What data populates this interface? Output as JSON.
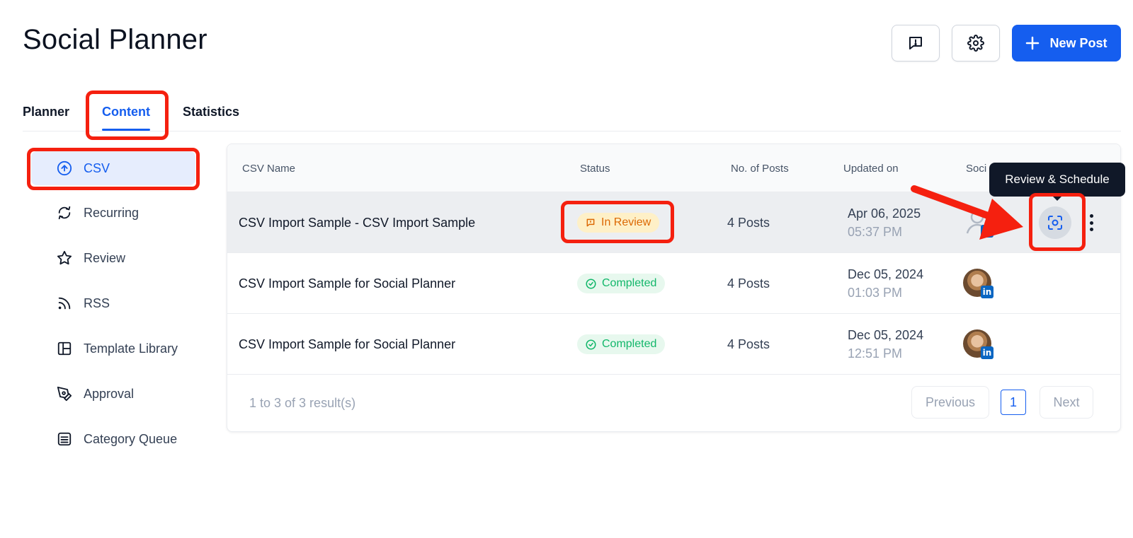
{
  "header": {
    "title": "Social Planner",
    "new_post_label": "New Post",
    "feedback_icon": "feedback-icon",
    "settings_icon": "gear-icon"
  },
  "tabs": [
    {
      "label": "Planner",
      "active": false
    },
    {
      "label": "Content",
      "active": true
    },
    {
      "label": "Statistics",
      "active": false
    }
  ],
  "sidebar": {
    "items": [
      {
        "label": "CSV",
        "icon": "upload-circle-icon",
        "active": true
      },
      {
        "label": "Recurring",
        "icon": "refresh-icon",
        "active": false
      },
      {
        "label": "Review",
        "icon": "star-icon",
        "active": false
      },
      {
        "label": "RSS",
        "icon": "rss-icon",
        "active": false
      },
      {
        "label": "Template Library",
        "icon": "layout-icon",
        "active": false
      },
      {
        "label": "Approval",
        "icon": "pen-icon",
        "active": false
      },
      {
        "label": "Category Queue",
        "icon": "list-icon",
        "active": false
      }
    ]
  },
  "table": {
    "columns": [
      "CSV Name",
      "Status",
      "No. of Posts",
      "Updated on",
      "Soci"
    ],
    "rows": [
      {
        "name": "CSV Import Sample  -  CSV Import Sample",
        "status": "In Review",
        "posts": "4 Posts",
        "date": "Apr 06, 2025",
        "time": "05:37 PM",
        "avatar": "placeholder",
        "network": "in"
      },
      {
        "name": "CSV Import Sample for Social Planner",
        "status": "Completed",
        "posts": "4 Posts",
        "date": "Dec 05, 2024",
        "time": "01:03 PM",
        "avatar": "photo",
        "network": "in"
      },
      {
        "name": "CSV Import Sample for Social Planner",
        "status": "Completed",
        "posts": "4 Posts",
        "date": "Dec 05, 2024",
        "time": "12:51 PM",
        "avatar": "photo",
        "network": "in"
      }
    ],
    "tooltip": "Review & Schedule",
    "review_icon": "scan-icon"
  },
  "pagination": {
    "summary": "1 to 3 of 3 result(s)",
    "previous": "Previous",
    "current": "1",
    "next": "Next"
  },
  "colors": {
    "accent": "#155eef",
    "review": "#dc6803",
    "completed": "#12b76a",
    "highlight": "#f5200f"
  }
}
